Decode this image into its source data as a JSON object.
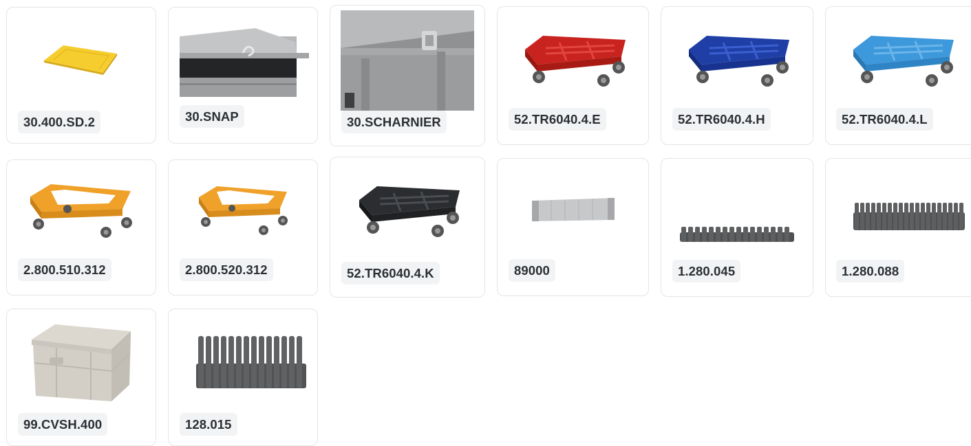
{
  "products": [
    {
      "code": "30.400.SD.2",
      "image": "yellow-lid"
    },
    {
      "code": "30.SNAP",
      "image": "snap-lid-crate"
    },
    {
      "code": "30.SCHARNIER",
      "image": "hinge-crate-closeup"
    },
    {
      "code": "52.TR6040.4.E",
      "image": "red-dolly",
      "color": "#c8231f"
    },
    {
      "code": "52.TR6040.4.H",
      "image": "blue-dolly",
      "color": "#1f3fa6"
    },
    {
      "code": "52.TR6040.4.L",
      "image": "light-blue-dolly",
      "color": "#3d98dc"
    },
    {
      "code": "2.800.510.312",
      "image": "orange-open-dolly",
      "color": "#f0a12a"
    },
    {
      "code": "2.800.520.312",
      "image": "orange-open-dolly-small",
      "color": "#f0a12a"
    },
    {
      "code": "52.TR6040.4.K",
      "image": "black-dolly",
      "color": "#2b2d30"
    },
    {
      "code": "89000",
      "image": "grey-divider-strip"
    },
    {
      "code": "1.280.045",
      "image": "short-comb-divider"
    },
    {
      "code": "1.280.088",
      "image": "tall-comb-divider"
    },
    {
      "code": "99.CVSH.400",
      "image": "grey-crate-with-lid"
    },
    {
      "code": "128.015",
      "image": "large-comb-divider"
    }
  ]
}
